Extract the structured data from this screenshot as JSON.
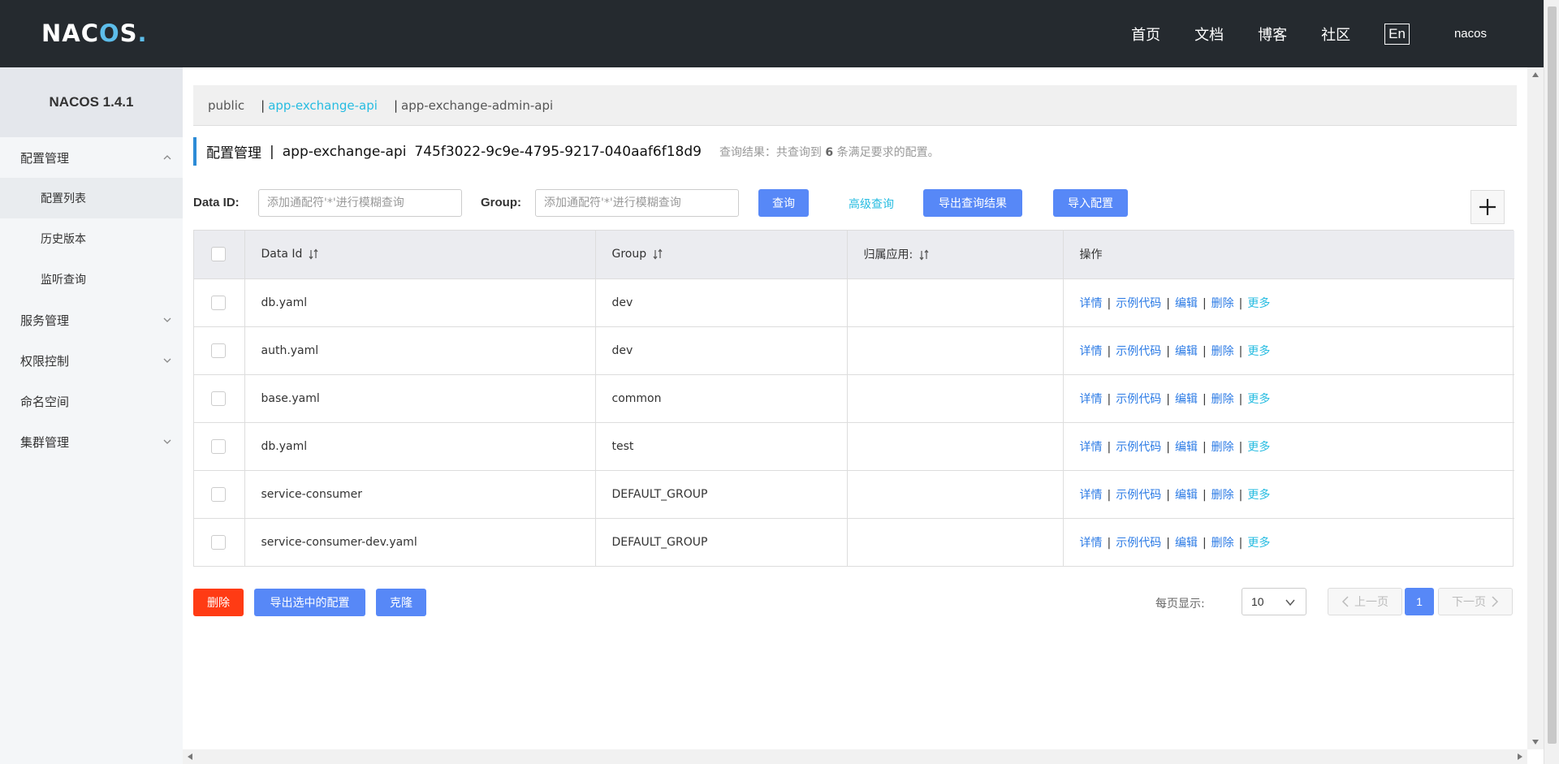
{
  "header": {
    "logo_text": "NAC",
    "logo_o": "O",
    "logo_tail": "S",
    "logo_dot": ".",
    "nav": [
      "首页",
      "文档",
      "博客",
      "社区"
    ],
    "lang": "En",
    "user": "nacos"
  },
  "sidebar": {
    "version": "NACOS 1.4.1",
    "items": [
      {
        "label": "配置管理",
        "expanded": true,
        "subitems": [
          "配置列表",
          "历史版本",
          "监听查询"
        ]
      },
      {
        "label": "服务管理",
        "expanded": false
      },
      {
        "label": "权限控制",
        "expanded": false
      },
      {
        "label": "命名空间"
      },
      {
        "label": "集群管理",
        "expanded": false
      }
    ],
    "active_subitem": "配置列表"
  },
  "namespaces": {
    "items": [
      "public",
      "app-exchange-api",
      "app-exchange-admin-api"
    ],
    "active": "app-exchange-api"
  },
  "title": {
    "section": "配置管理",
    "sep": "|",
    "namespace": "app-exchange-api",
    "namespace_id": "745f3022-9c9e-4795-9217-040aaf6f18d9",
    "result_prefix": "查询结果：共查询到",
    "result_count": "6",
    "result_suffix": "条满足要求的配置。"
  },
  "query": {
    "dataid_label": "Data ID:",
    "dataid_placeholder": "添加通配符'*'进行模糊查询",
    "group_label": "Group:",
    "group_placeholder": "添加通配符'*'进行模糊查询",
    "search_label": "查询",
    "advanced_label": "高级查询",
    "export_label": "导出查询结果",
    "import_label": "导入配置"
  },
  "table": {
    "headers": [
      "Data Id",
      "Group",
      "归属应用:",
      "操作"
    ],
    "rows": [
      {
        "data_id": "db.yaml",
        "group": "dev",
        "app": ""
      },
      {
        "data_id": "auth.yaml",
        "group": "dev",
        "app": ""
      },
      {
        "data_id": "base.yaml",
        "group": "common",
        "app": ""
      },
      {
        "data_id": "db.yaml",
        "group": "test",
        "app": ""
      },
      {
        "data_id": "service-consumer",
        "group": "DEFAULT_GROUP",
        "app": ""
      },
      {
        "data_id": "service-consumer-dev.yaml",
        "group": "DEFAULT_GROUP",
        "app": ""
      }
    ],
    "ops": {
      "detail": "详情",
      "sample": "示例代码",
      "edit": "编辑",
      "delete": "删除",
      "more": "更多",
      "sep": "|"
    }
  },
  "bottom": {
    "delete_label": "删除",
    "export_selected_label": "导出选中的配置",
    "clone_label": "克隆",
    "page_size_label": "每页显示:",
    "page_size": "10",
    "prev_label": "上一页",
    "current_page": "1",
    "next_label": "下一页"
  },
  "colors": {
    "header_bg": "#252a2f",
    "primary": "#5788f7",
    "danger": "#ff3b14",
    "link": "#27bce1",
    "op_link": "#2c7be5"
  }
}
